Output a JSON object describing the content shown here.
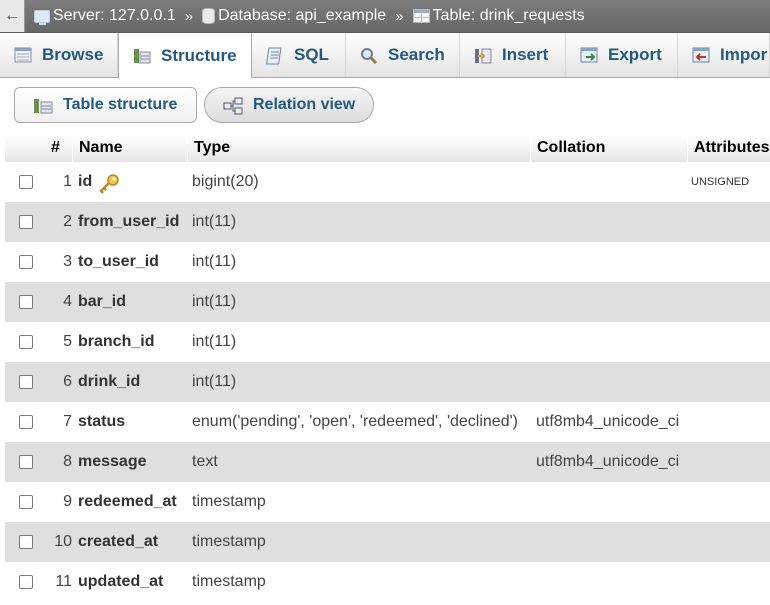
{
  "breadcrumb": {
    "back_glyph": "←",
    "server": "Server: 127.0.0.1",
    "database": "Database: api_example",
    "table": "Table: drink_requests",
    "separator": "»"
  },
  "tabs": [
    {
      "label": "Browse",
      "icon": "browse-icon"
    },
    {
      "label": "Structure",
      "icon": "structure-icon",
      "active": true
    },
    {
      "label": "SQL",
      "icon": "sql-icon"
    },
    {
      "label": "Search",
      "icon": "search-icon"
    },
    {
      "label": "Insert",
      "icon": "insert-icon"
    },
    {
      "label": "Export",
      "icon": "export-icon"
    },
    {
      "label": "Impor",
      "icon": "import-icon"
    }
  ],
  "subtabs": {
    "table_structure": "Table structure",
    "relation_view": "Relation view"
  },
  "table": {
    "headers": {
      "num": "#",
      "name": "Name",
      "type": "Type",
      "collation": "Collation",
      "attributes": "Attributes"
    },
    "rows": [
      {
        "num": "1",
        "name": "id",
        "type": "bigint(20)",
        "collation": "",
        "attributes": "UNSIGNED",
        "primary": true
      },
      {
        "num": "2",
        "name": "from_user_id",
        "type": "int(11)",
        "collation": "",
        "attributes": ""
      },
      {
        "num": "3",
        "name": "to_user_id",
        "type": "int(11)",
        "collation": "",
        "attributes": ""
      },
      {
        "num": "4",
        "name": "bar_id",
        "type": "int(11)",
        "collation": "",
        "attributes": ""
      },
      {
        "num": "5",
        "name": "branch_id",
        "type": "int(11)",
        "collation": "",
        "attributes": ""
      },
      {
        "num": "6",
        "name": "drink_id",
        "type": "int(11)",
        "collation": "",
        "attributes": ""
      },
      {
        "num": "7",
        "name": "status",
        "type": "enum('pending', 'open', 'redeemed', 'declined')",
        "collation": "utf8mb4_unicode_ci",
        "attributes": ""
      },
      {
        "num": "8",
        "name": "message",
        "type": "text",
        "collation": "utf8mb4_unicode_ci",
        "attributes": ""
      },
      {
        "num": "9",
        "name": "redeemed_at",
        "type": "timestamp",
        "collation": "",
        "attributes": ""
      },
      {
        "num": "10",
        "name": "created_at",
        "type": "timestamp",
        "collation": "",
        "attributes": ""
      },
      {
        "num": "11",
        "name": "updated_at",
        "type": "timestamp",
        "collation": "",
        "attributes": ""
      }
    ]
  },
  "colors": {
    "link": "#235a81",
    "row_even": "#dfdfdf",
    "crumb_bg": "#737373"
  }
}
